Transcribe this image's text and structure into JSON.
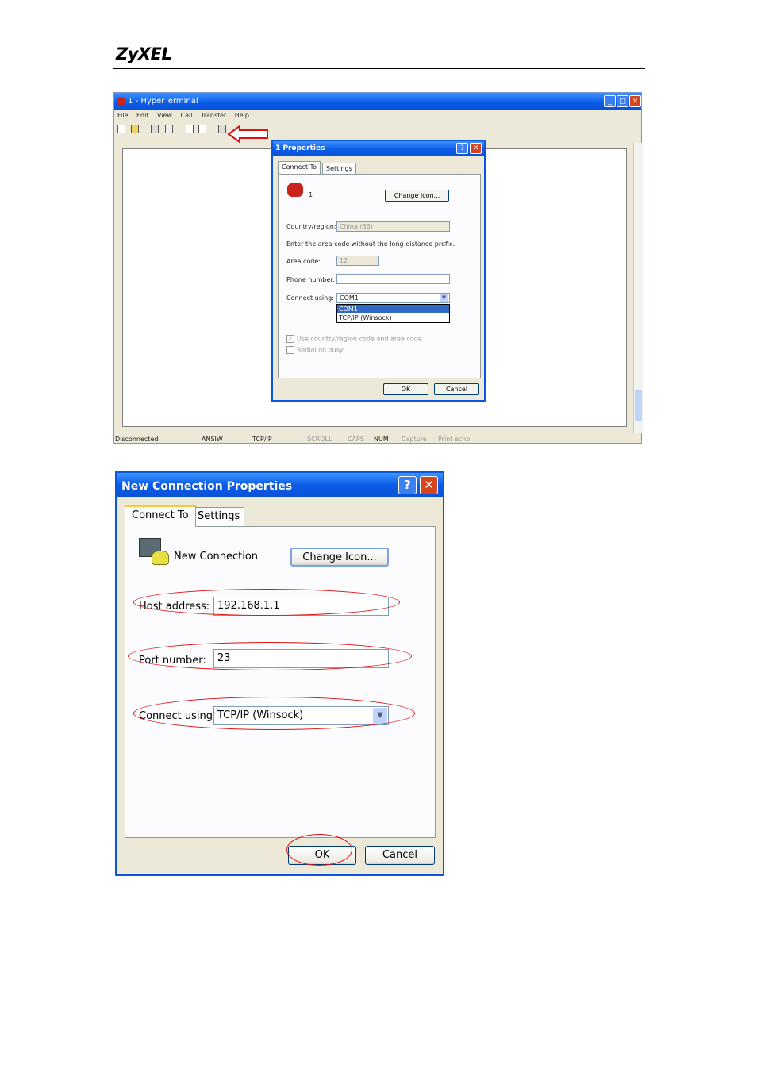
{
  "header": {
    "logo": "ZyXEL"
  },
  "hyperterminal": {
    "title": "1 - HyperTerminal",
    "menu": [
      "File",
      "Edit",
      "View",
      "Call",
      "Transfer",
      "Help"
    ],
    "status": {
      "connection": "Disconnected",
      "emulation": "ANSIW",
      "protocol": "TCP/IP",
      "scroll": "SCROLL",
      "caps": "CAPS",
      "num": "NUM",
      "capture": "Capture",
      "print_echo": "Print echo"
    },
    "properties_dialog": {
      "title": "1 Properties",
      "tabs": [
        "Connect To",
        "Settings"
      ],
      "connection_name": "1",
      "change_icon": "Change Icon...",
      "country_label": "Country/region:",
      "country_value": "China (86)",
      "area_note": "Enter the area code without the long-distance prefix.",
      "area_label": "Area code:",
      "area_value": "12",
      "phone_label": "Phone number:",
      "phone_value": "",
      "connect_label": "Connect using:",
      "connect_value": "COM1",
      "connect_options": [
        "COM1",
        "TCP/IP (Winsock)"
      ],
      "use_country": "Use country/region code and area code",
      "redial": "Redial on busy",
      "ok": "OK",
      "cancel": "Cancel"
    }
  },
  "new_connection": {
    "title": "New Connection Properties",
    "tabs": [
      "Connect To",
      "Settings"
    ],
    "name": "New Connection",
    "change_icon": "Change Icon...",
    "host_label": "Host address:",
    "host_value": "192.168.1.1",
    "port_label": "Port number:",
    "port_value": "23",
    "connect_label": "Connect using:",
    "connect_value": "TCP/IP (Winsock)",
    "ok": "OK",
    "cancel": "Cancel"
  },
  "colors": {
    "annotation": "#e01010",
    "xp_title": "#0a5ce8"
  }
}
